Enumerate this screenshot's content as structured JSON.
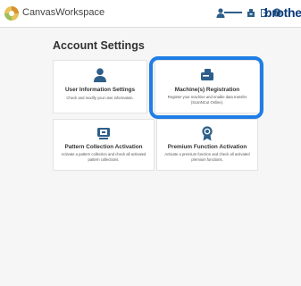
{
  "header": {
    "app_title": "CanvasWorkspace",
    "brand": "brother",
    "icons": [
      "user-icon",
      "import-icon",
      "export-icon",
      "help-icon"
    ]
  },
  "page": {
    "title": "Account Settings"
  },
  "cards": {
    "user_info": {
      "icon": "user-icon",
      "title": "User Information Settings",
      "description": "Check and modify your user information."
    },
    "machine_registration": {
      "icon": "machine-icon",
      "title": "Machine(s) Registration",
      "description": "Register your machine and enable data transfer (ScanNCut Online)."
    },
    "pattern_collection": {
      "icon": "pattern-icon",
      "title": "Pattern Collection Activation",
      "description": "Activate a pattern collection and check all activated pattern collections."
    },
    "premium_function": {
      "icon": "badge-icon",
      "title": "Premium Function Activation",
      "description": "Activate a premium function and check all activated premium functions."
    }
  },
  "colors": {
    "accent": "#1f7ee6",
    "icon": "#2e5f8a",
    "brand": "#0a3a7a"
  }
}
